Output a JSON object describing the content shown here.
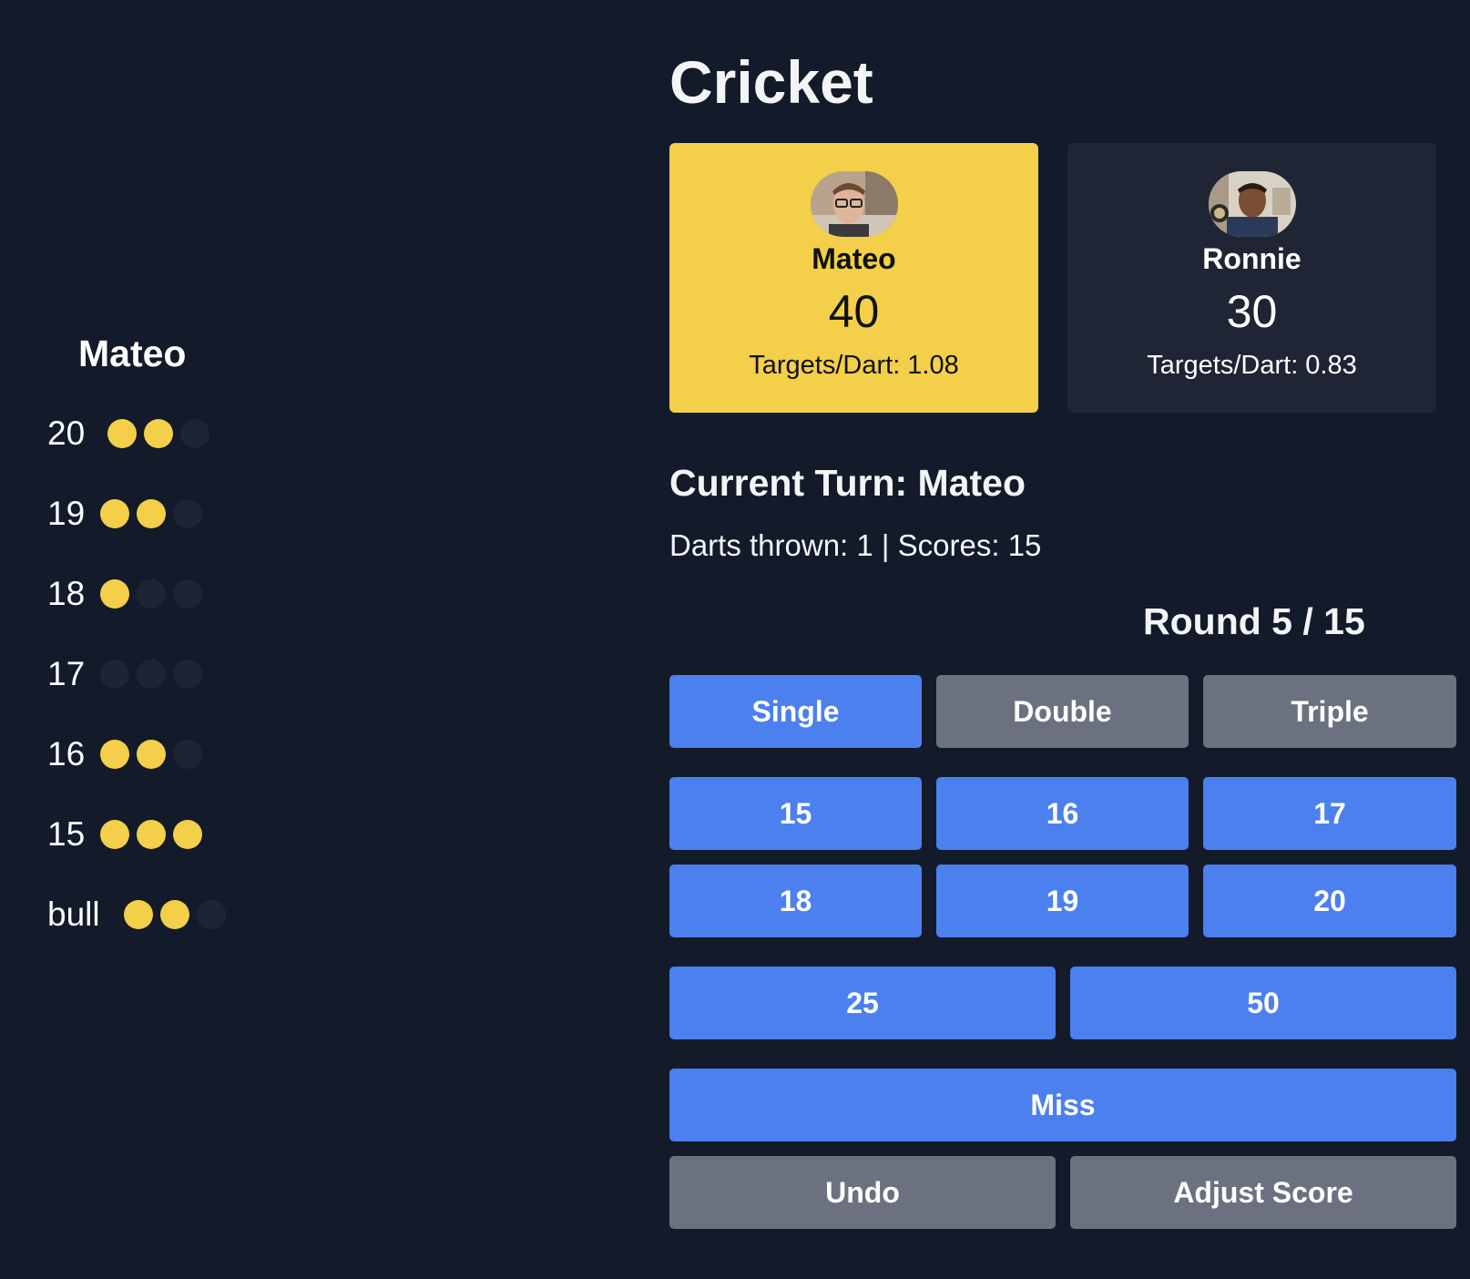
{
  "colors": {
    "background": "#131a2a",
    "accent_yellow": "#f3cf4a",
    "button_blue": "#4b80ee",
    "button_gray": "#6c717f",
    "card_dark": "#1f2534",
    "dot_empty": "#1e2434"
  },
  "marks": {
    "player": "Mateo",
    "rows": [
      {
        "label": "20",
        "hits": 2,
        "max": 3
      },
      {
        "label": "19",
        "hits": 2,
        "max": 3
      },
      {
        "label": "18",
        "hits": 1,
        "max": 3
      },
      {
        "label": "17",
        "hits": 0,
        "max": 3
      },
      {
        "label": "16",
        "hits": 2,
        "max": 3
      },
      {
        "label": "15",
        "hits": 3,
        "max": 3
      },
      {
        "label": "bull",
        "hits": 2,
        "max": 3
      }
    ]
  },
  "game": {
    "title": "Cricket",
    "players": [
      {
        "name": "Mateo",
        "score": "40",
        "stat": "Targets/Dart: 1.08",
        "active": true,
        "avatar": "player-photo"
      },
      {
        "name": "Ronnie",
        "score": "30",
        "stat": "Targets/Dart: 0.83",
        "active": false,
        "avatar": "player-photo"
      }
    ],
    "current_turn": "Current Turn: Mateo",
    "turn_info": "Darts thrown: 1 | Scores: 15",
    "round": "Round 5 / 15"
  },
  "controls": {
    "multipliers": [
      {
        "label": "Single",
        "selected": true
      },
      {
        "label": "Double",
        "selected": false
      },
      {
        "label": "Triple",
        "selected": false
      }
    ],
    "numbers": [
      "15",
      "16",
      "17",
      "18",
      "19",
      "20"
    ],
    "bulls": [
      "25",
      "50"
    ],
    "miss": "Miss",
    "undo": "Undo",
    "adjust": "Adjust Score"
  }
}
